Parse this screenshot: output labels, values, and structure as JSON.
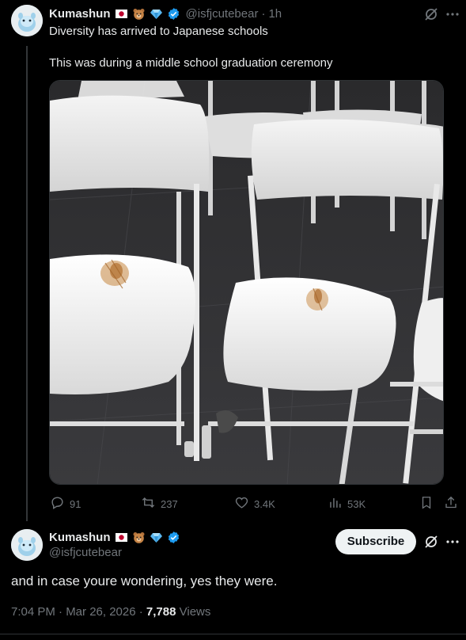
{
  "colors": {
    "background": "#000000",
    "text": "#e7e9ea",
    "muted": "#71767b",
    "verified": "#1d9bf0",
    "divider": "#2f3336"
  },
  "post": {
    "author_name": "Kumashun",
    "handle": "@isfjcutebear",
    "time": "1h",
    "text_line1": "Diversity has arrived to Japanese schools",
    "text_line2": "This was during a middle school graduation ceremony",
    "image_alt_subject": "white folding chairs",
    "actions": {
      "replies": "91",
      "reposts": "237",
      "likes": "3.4K",
      "views": "53K"
    },
    "icons": [
      "grok-icon",
      "more-icon",
      "reply-icon",
      "repost-icon",
      "like-icon",
      "views-icon",
      "bookmark-icon",
      "share-icon"
    ]
  },
  "reply": {
    "author_name": "Kumashun",
    "handle": "@isfjcutebear",
    "subscribe_label": "Subscribe",
    "text": "and in case youre wondering, yes they were.",
    "timestamp": "7:04 PM · Mar 26, 2026 · ",
    "views_count": "7,788",
    "views_label": " Views"
  }
}
